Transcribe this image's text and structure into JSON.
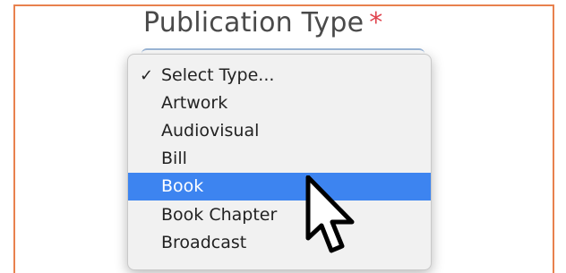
{
  "field": {
    "label": "Publication Type",
    "required_marker": "*"
  },
  "dropdown": {
    "options": [
      {
        "label": "Select Type...",
        "checked": true,
        "check_mark": "✓",
        "highlighted": false
      },
      {
        "label": "Artwork",
        "checked": false,
        "highlighted": false
      },
      {
        "label": "Audiovisual",
        "checked": false,
        "highlighted": false
      },
      {
        "label": "Bill",
        "checked": false,
        "highlighted": false
      },
      {
        "label": "Book",
        "checked": false,
        "highlighted": true
      },
      {
        "label": "Book Chapter",
        "checked": false,
        "highlighted": false
      },
      {
        "label": "Broadcast",
        "checked": false,
        "highlighted": false
      }
    ]
  },
  "colors": {
    "frame_border": "#e8814e",
    "required_star": "#e0454f",
    "highlight": "#3d84f0"
  },
  "icons": {
    "pointer": "mouse-pointer-icon"
  }
}
